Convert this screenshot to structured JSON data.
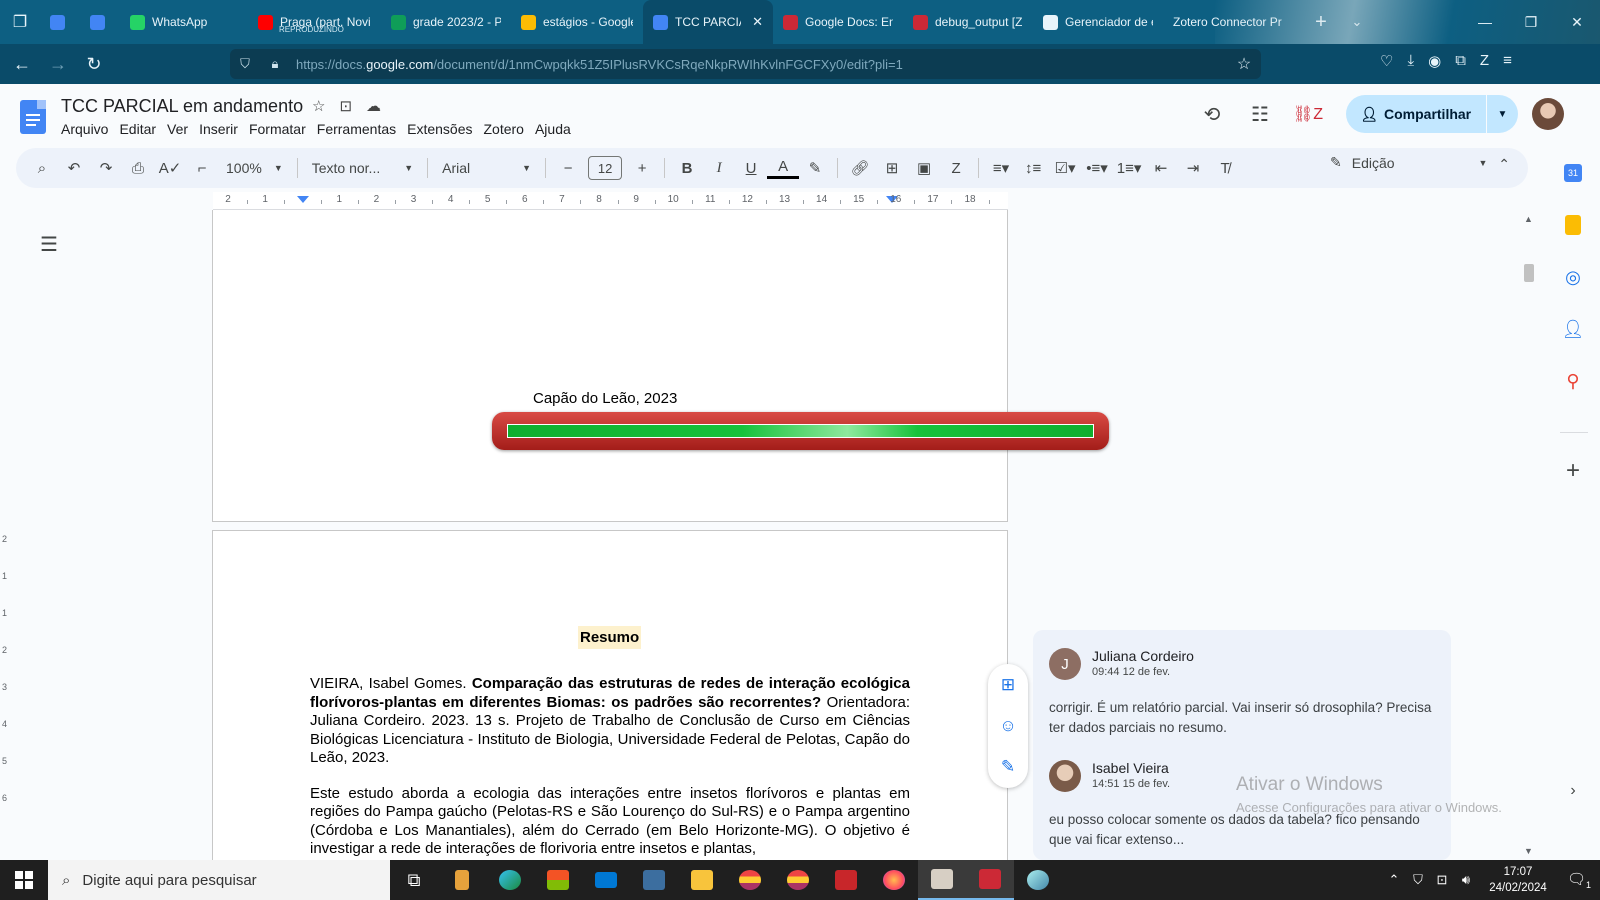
{
  "browser": {
    "tabs": [
      {
        "label": "",
        "icon": "docs-icon",
        "color": "#4285f4"
      },
      {
        "label": "",
        "icon": "docs-icon",
        "color": "#4285f4"
      },
      {
        "label": "WhatsApp",
        "icon": "whatsapp-icon",
        "color": "#25d366"
      },
      {
        "label": "Praga (part. Novi",
        "sub": "REPRODUZINDO",
        "icon": "youtube-icon",
        "color": "#ff0000"
      },
      {
        "label": "grade 2023/2 - Pl",
        "icon": "sheets-icon",
        "color": "#0f9d58"
      },
      {
        "label": "estágios - Google",
        "icon": "drive-icon",
        "color": "#fbbc04"
      },
      {
        "label": "TCC PARCIAL",
        "icon": "docs-icon",
        "color": "#4285f4",
        "active": true
      },
      {
        "label": "Google Docs: Enc",
        "icon": "zotero-icon",
        "color": "#cc2936"
      },
      {
        "label": "debug_output [Z",
        "icon": "zotero-icon",
        "color": "#cc2936"
      },
      {
        "label": "Gerenciador de e",
        "icon": "extension-icon",
        "color": "#e8f4fa"
      },
      {
        "label": "Zotero Connector Pr",
        "icon": "",
        "color": ""
      }
    ],
    "url_prefix": "https://docs.",
    "url_domain": "google.com",
    "url_path": "/document/d/1nmCwpqkk51Z5IPlusRVKCsRqeNkpRWIhKvlnFGCFXy0/edit?pli=1"
  },
  "docs": {
    "title": "TCC PARCIAL em andamento",
    "menu": [
      "Arquivo",
      "Editar",
      "Ver",
      "Inserir",
      "Formatar",
      "Ferramentas",
      "Extensões",
      "Zotero",
      "Ajuda"
    ],
    "share_label": "Compartilhar",
    "toolbar": {
      "zoom": "100%",
      "style": "Texto nor...",
      "font": "Arial",
      "font_size": "12",
      "mode": "Edição"
    }
  },
  "ruler": {
    "labels": [
      "2",
      "1",
      "",
      "1",
      "2",
      "3",
      "4",
      "5",
      "6",
      "7",
      "8",
      "9",
      "10",
      "11",
      "12",
      "13",
      "14",
      "15",
      "16",
      "17",
      "18"
    ],
    "left_labels": [
      "2",
      "1",
      "1",
      "2",
      "3",
      "4",
      "5",
      "6"
    ]
  },
  "document": {
    "page1_place": "Capão do Leão, 2023",
    "resumo_title": "Resumo",
    "reference_author": "VIEIRA, Isabel Gomes. ",
    "reference_title": "Comparação das estruturas de redes de interação ecológica florívoros-plantas em diferentes Biomas: os padrões são recorrentes?",
    "reference_rest": " Orientadora: Juliana Cordeiro. 2023. 13 s. Projeto de Trabalho de Conclusão de Curso em Ciências Biológicas Licenciatura - Instituto de Biologia, Universidade Federal de Pelotas, Capão do Leão, 2023.",
    "abstract": "Este estudo aborda a ecologia das interações entre insetos florívoros e plantas em regiões do Pampa gaúcho (Pelotas-RS e São Lourenço do Sul-RS) e o Pampa argentino (Córdoba e Los Manantiales), além do Cerrado (em Belo Horizonte-MG). O objetivo é investigar a rede de interações de florivoria entre insetos e plantas,"
  },
  "loading_overlay": {
    "progress": 1.0,
    "bar_color": "#c0312c",
    "fill_color": "#17c23b"
  },
  "comments": [
    {
      "initial": "J",
      "name": "Juliana Cordeiro",
      "time": "09:44 12 de fev.",
      "text": "corrigir. É um relatório parcial. Vai inserir só drosophila? Precisa ter dados parciais no resumo."
    },
    {
      "initial": "",
      "name": "Isabel Vieira",
      "time": "14:51 15 de fev.",
      "text": "eu posso colocar somente os dados da tabela? fico pensando que vai ficar extenso..."
    }
  ],
  "watermark": {
    "line1": "Ativar o Windows",
    "line2": "Acesse Configurações para ativar o Windows."
  },
  "taskbar": {
    "search_placeholder": "Digite aqui para pesquisar",
    "time": "17:07",
    "date": "24/02/2024",
    "notifications": "1"
  }
}
